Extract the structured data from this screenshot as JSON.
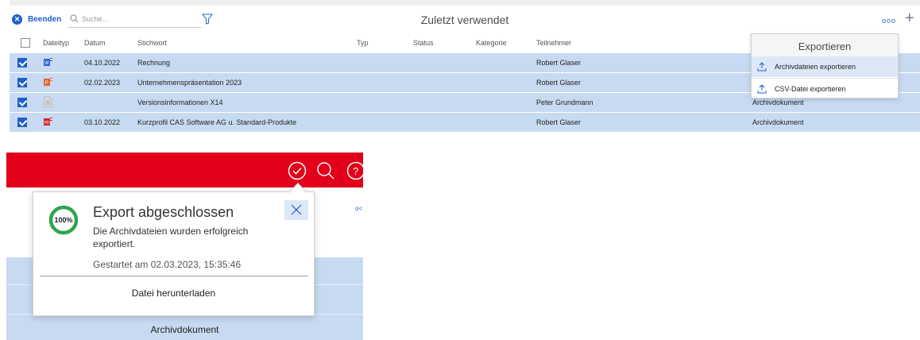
{
  "toolbar": {
    "end_label": "Beenden",
    "search_placeholder": "Suche...",
    "view_title": "Zuletzt verwendet"
  },
  "columns": [
    "Dateityp",
    "Datum",
    "Stichwort",
    "Typ",
    "Status",
    "Kategorie",
    "Teilnehmer"
  ],
  "rows": [
    {
      "filetype_icon": "word-doc-icon",
      "date": "04.10.2022",
      "keyword": "Rechnung",
      "participant": "Robert Glaser",
      "extra": "",
      "selected": true
    },
    {
      "filetype_icon": "powerpoint-doc-icon",
      "date": "02.02.2023",
      "keyword": "Unternehmenspräsentation 2023",
      "participant": "Robert Glaser",
      "extra": "",
      "selected": true
    },
    {
      "filetype_icon": "generic-doc-icon",
      "date": "",
      "keyword": "Versionsinformationen X14",
      "participant": "Peter Grundmann",
      "extra": "Archivdokument",
      "selected": true
    },
    {
      "filetype_icon": "pdf-doc-icon",
      "date": "03.10.2022",
      "keyword": "Kurzprofil CAS Software AG u. Standard-Produkte",
      "participant": "Robert Glaser",
      "extra": "Archivdokument",
      "selected": true
    }
  ],
  "export_menu": {
    "title": "Exportieren",
    "items": [
      "Archivdateien exportieren",
      "CSV-Datei exportieren"
    ]
  },
  "popup": {
    "progress": "100%",
    "progress_value": 1.0,
    "title": "Export abgeschlossen",
    "message": "Die Archivdateien wurden erfolgreich exportiert.",
    "started": "Gestartet am 02.03.2023, 15:35:46",
    "download_label": "Datei herunterladen"
  },
  "bottom": {
    "row_label": "Archivdokument"
  },
  "colors": {
    "accent": "#1f5fc9",
    "brand_red": "#e2001a",
    "selection": "#c8daf2",
    "progress_green": "#2ea44f"
  }
}
